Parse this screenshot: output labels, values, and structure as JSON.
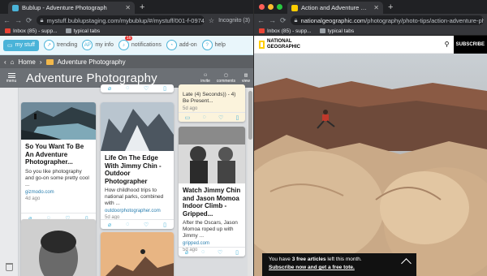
{
  "left_window": {
    "tab_title": "Bublup - Adventure Photograph",
    "url": "mystuff.bublupstaging.com/mybublup/#/mystuff/001-f-09743b82-c...",
    "incognito": "Incognito (3)",
    "bookmarks": [
      "Inbox (85) - supp...",
      "typical tabs"
    ],
    "nav": [
      {
        "label": "my stuff",
        "icon": "folder-icon"
      },
      {
        "label": "trending",
        "icon": "trending-icon"
      },
      {
        "label": "my info",
        "icon": "profile-icon",
        "avatar": "AP"
      },
      {
        "label": "notifications",
        "icon": "bell-icon",
        "badge": "16"
      },
      {
        "label": "add-on",
        "icon": "addon-icon"
      },
      {
        "label": "help",
        "icon": "help-icon"
      }
    ],
    "breadcrumb": {
      "home": "Home",
      "folder": "Adventure Photography"
    },
    "folder": {
      "menu_label": "menu",
      "title": "Adventure Photography",
      "tools": [
        "invite",
        "comments",
        "view"
      ]
    },
    "cards": [
      {
        "title": "So You Want To Be An Adventure Photographer...",
        "desc": "So you like photography and go-on some pretty cool ...",
        "src": "gizmodo.com",
        "age": "4d ago"
      },
      {
        "title": "Life On The Edge With Jimmy Chin - Outdoor Photographer",
        "desc": "How childhood trips to national parks, combined with ...",
        "src": "outdoorphotographer.com",
        "age": "5d ago"
      },
      {
        "title": "Watch Jimmy Chin and Jason Momoa Indoor Climb - Gripped...",
        "desc": "After the Oscars, Jason Momoa roped up with Jimmy ...",
        "src": "gripped.com",
        "age": "5d ago"
      },
      {
        "title": "",
        "desc": "Late (4) Seconds)) - 4) Be Present...",
        "src": "",
        "age": "5d ago"
      }
    ]
  },
  "right_window": {
    "tab_title": "Action and Adventure Photogra",
    "url_host": "nationalgeographic.com",
    "url_path": "/photography/photo-tips/action-adventure-photo...",
    "bookmarks": [
      "Inbox (85) - supp...",
      "typical tabs"
    ],
    "logo": [
      "NATIONAL",
      "GEOGRAPHIC"
    ],
    "subscribe": "SUBSCRIBE",
    "paywall": {
      "pre": "You have ",
      "count": "3 free articles",
      "post": " left this month.",
      "cta": "Subscribe now and get a free tote."
    }
  },
  "colors": {
    "bublup_blue": "#4ab3d8",
    "natgeo_yellow": "#ffce00"
  }
}
